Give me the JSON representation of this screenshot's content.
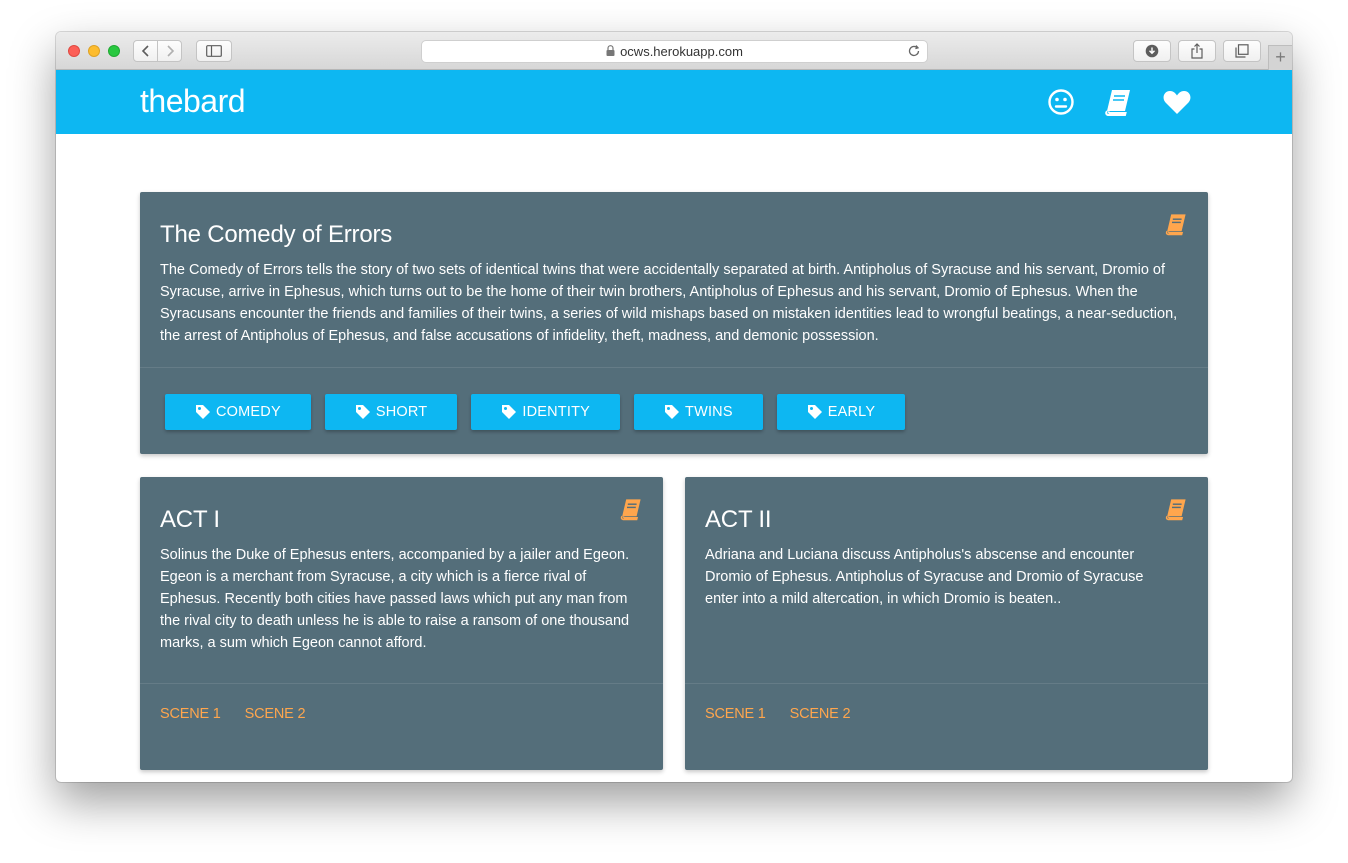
{
  "browser": {
    "url": "ocws.herokuapp.com"
  },
  "header": {
    "brand": "thebard",
    "nav_icons": [
      "neutral-face-icon",
      "book-icon",
      "heart-icon"
    ],
    "bar_color": "#0db7f2"
  },
  "play": {
    "title": "The Comedy of Errors",
    "description": "The Comedy of Errors tells the story of two sets of identical twins that were accidentally separated at birth. Antipholus of Syracuse and his servant, Dromio of Syracuse, arrive in Ephesus, which turns out to be the home of their twin brothers, Antipholus of Ephesus and his servant, Dromio of Ephesus. When the Syracusans encounter the friends and families of their twins, a series of wild mishaps based on mistaken identities lead to wrongful beatings, a near-seduction, the arrest of Antipholus of Ephesus, and false accusations of infidelity, theft, madness, and demonic possession.",
    "icon": "book-icon",
    "tags": [
      "COMEDY",
      "SHORT",
      "IDENTITY",
      "TWINS",
      "EARLY"
    ]
  },
  "acts": [
    {
      "title": "ACT I",
      "summary": "Solinus the Duke of Ephesus enters, accompanied by a jailer and Egeon. Egeon is a merchant from Syracuse, a city which is a fierce rival of Ephesus. Recently both cities have passed laws which put any man from the rival city to death unless he is able to raise a ransom of one thousand marks, a sum which Egeon cannot afford.",
      "scenes": [
        "SCENE 1",
        "SCENE 2"
      ]
    },
    {
      "title": "ACT II",
      "summary": "Adriana and Luciana discuss Antipholus's abscense and encounter Dromio of Ephesus. Antipholus of Syracuse and Dromio of Syracuse enter into a mild altercation, in which Dromio is beaten..",
      "scenes": [
        "SCENE 1",
        "SCENE 2"
      ]
    }
  ],
  "colors": {
    "card": "#546e7a",
    "accent_orange": "#ffa64d",
    "primary": "#0db7f2"
  }
}
